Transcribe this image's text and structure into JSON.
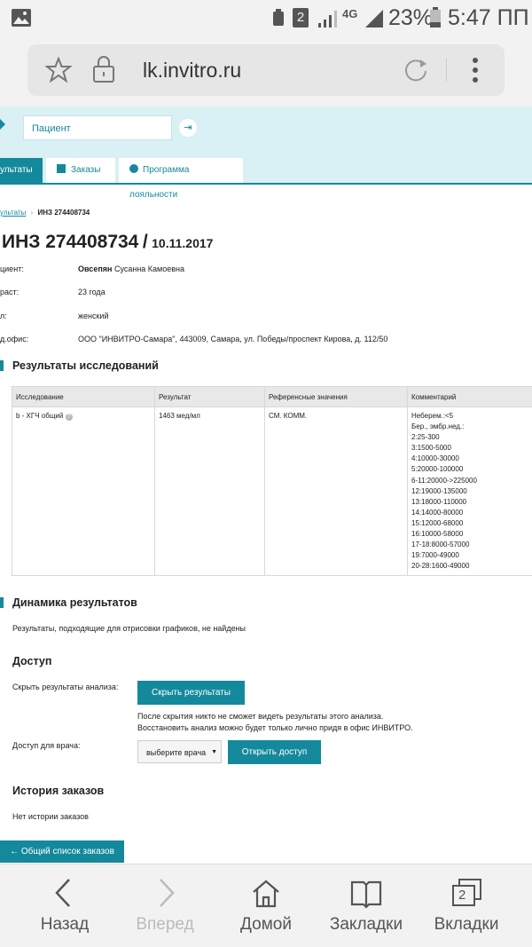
{
  "status_bar": {
    "battery": "23%",
    "time": "5:47 ПП",
    "network": "4G",
    "sim": "2"
  },
  "browser": {
    "url": "lk.invitro.ru"
  },
  "site": {
    "patient_placeholder": "Пациент",
    "tabs": [
      {
        "label": "ультаты"
      },
      {
        "label": "Заказы"
      },
      {
        "label": "Программа лояльности"
      }
    ],
    "breadcrumb": {
      "parent": "ультаты",
      "sep": "›",
      "current": "ИНЗ 274408734"
    },
    "title": "ИНЗ 274408734",
    "title_sep": "/",
    "title_date": "10.11.2017",
    "fields": [
      {
        "label": "циент:",
        "value_bold": "Овсепян",
        "value": " Сусанна Камоевна"
      },
      {
        "label": "раст:",
        "value_bold": "",
        "value": "23 года"
      },
      {
        "label": "л:",
        "value_bold": "",
        "value": "женский"
      },
      {
        "label": "д.офис:",
        "value_bold": "",
        "value": "ООО \"ИНВИТРО-Самара\", 443009, Самара, ул. Победы/проспект Кирова, д. 112/50"
      }
    ]
  },
  "results": {
    "heading": "Результаты исследований",
    "columns": [
      "Исследование",
      "Результат",
      "Референсные значения",
      "Комментарий"
    ],
    "row": {
      "test": "b - ХГЧ общий",
      "result": "1463 мед/мл",
      "reference": "СМ. КОММ.",
      "comment": [
        "Неберем.:<5",
        "Бер., эмбр.нед.:",
        "2:25-300",
        "3:1500-5000",
        "4:10000-30000",
        "5:20000-100000",
        "6-11:20000->225000",
        "12:19000-135000",
        "13:18000-110000",
        "14:14000-80000",
        "15:12000-68000",
        "16:10000-58000",
        "17-18:8000-57000",
        "19:7000-49000",
        "20-28:1600-49000"
      ]
    }
  },
  "dynamics": {
    "heading": "Динамика результатов",
    "text": "Результаты, подходящие для отрисовки графиков, не найдены"
  },
  "access": {
    "heading": "Доступ",
    "hide_label": "Скрыть результаты анализа:",
    "hide_button": "Скрыть результаты",
    "note1": "После скрытия никто не сможет видеть результаты этого анализа.",
    "note2": "Восстановить анализ можно будет только лично придя в офис ИНВИТРО.",
    "doctor_label": "Доступ для врача:",
    "doctor_select": "выберите врача",
    "open_button": "Открыть доступ"
  },
  "history": {
    "heading": "История заказов",
    "text": "Нет истории заказов",
    "back_button": "← Общий список заказов"
  },
  "bottom_nav": [
    {
      "label": "Назад",
      "icon": "back-chevron-icon"
    },
    {
      "label": "Вперед",
      "icon": "forward-chevron-icon"
    },
    {
      "label": "Домой",
      "icon": "home-icon"
    },
    {
      "label": "Закладки",
      "icon": "bookmarks-icon"
    },
    {
      "label": "Вкладки",
      "icon": "tabs-icon",
      "count": "2"
    }
  ],
  "colors": {
    "accent": "#14899c",
    "header_bg": "#d9f0f4"
  }
}
